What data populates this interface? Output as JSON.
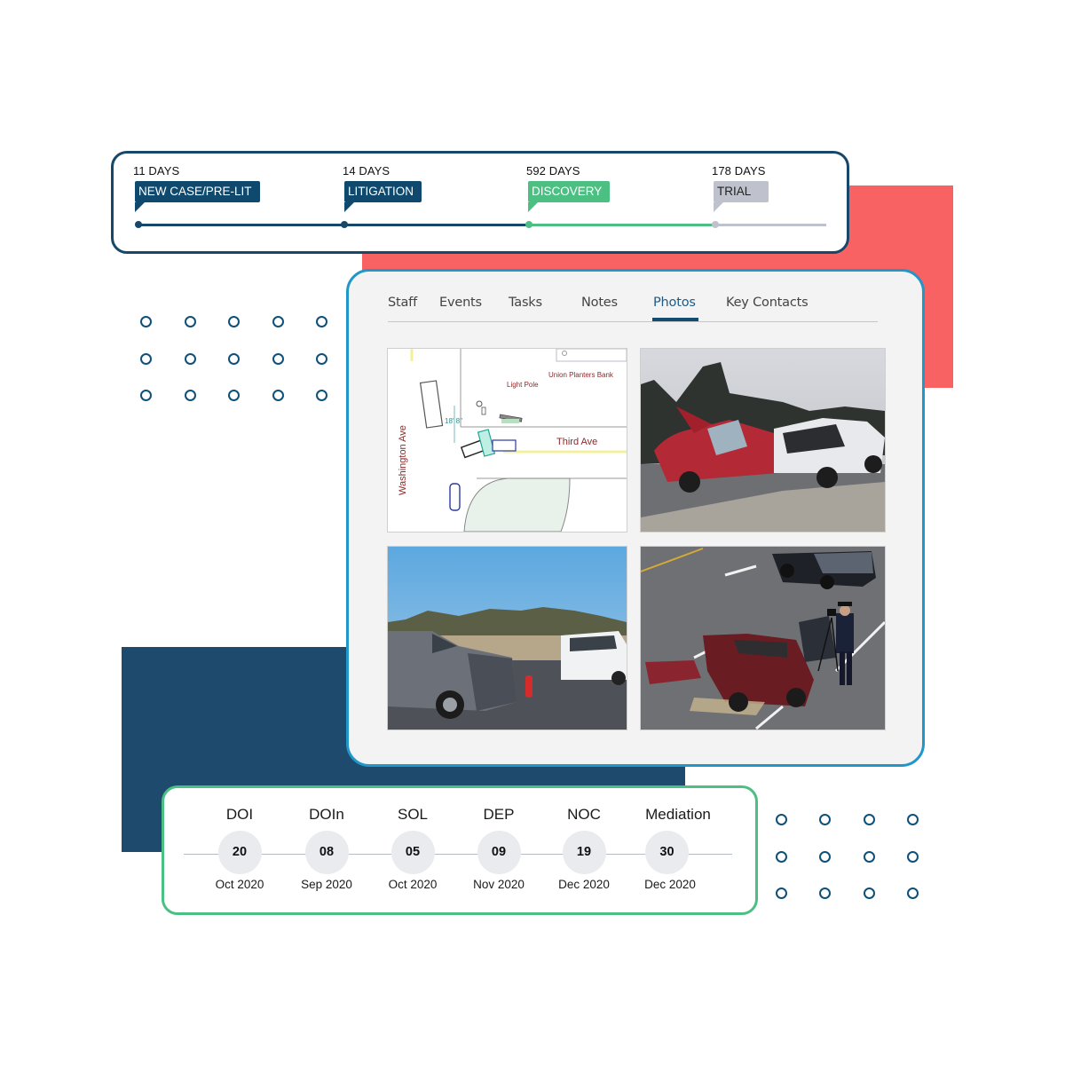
{
  "colors": {
    "navy": "#17486a",
    "tag_navy": "#0f4a6e",
    "green": "#4cc083",
    "gray": "#bfc1cc",
    "coral": "#f86262",
    "panel_border": "#2196c9"
  },
  "phase_timeline": {
    "phases": [
      {
        "days": "11 DAYS",
        "label": "NEW CASE/PRE-LIT",
        "status": "complete"
      },
      {
        "days": "14 DAYS",
        "label": "LITIGATION",
        "status": "complete"
      },
      {
        "days": "592 DAYS",
        "label": "DISCOVERY",
        "status": "current"
      },
      {
        "days": "178 DAYS",
        "label": "TRIAL",
        "status": "upcoming"
      }
    ]
  },
  "case_panel": {
    "tabs": [
      {
        "label": "Staff"
      },
      {
        "label": "Events"
      },
      {
        "label": "Tasks"
      },
      {
        "label": "Notes"
      },
      {
        "label": "Photos",
        "active": true
      },
      {
        "label": "Key Contacts"
      }
    ],
    "active_tab": "Photos",
    "photos": [
      {
        "kind": "accident-diagram",
        "labels": {
          "street_vertical": "Washington Ave",
          "street_horizontal": "Third Ave",
          "landmark": "Union Planters Bank",
          "light_pole": "Light Pole",
          "measurement": "18' 8\""
        }
      },
      {
        "kind": "photo",
        "description": "red sedan and white pickup head-on collision"
      },
      {
        "kind": "photo",
        "description": "gray SUV and white pickup crash on open road"
      },
      {
        "kind": "photo",
        "description": "wrecked red car with officer photographing scene"
      }
    ]
  },
  "key_dates": {
    "items": [
      {
        "label": "DOI",
        "day": "20",
        "month": "Oct 2020"
      },
      {
        "label": "DOIn",
        "day": "08",
        "month": "Sep 2020"
      },
      {
        "label": "SOL",
        "day": "05",
        "month": "Oct 2020"
      },
      {
        "label": "DEP",
        "day": "09",
        "month": "Nov 2020"
      },
      {
        "label": "NOC",
        "day": "19",
        "month": "Dec 2020"
      },
      {
        "label": "Mediation",
        "day": "30",
        "month": "Dec 2020"
      }
    ]
  }
}
